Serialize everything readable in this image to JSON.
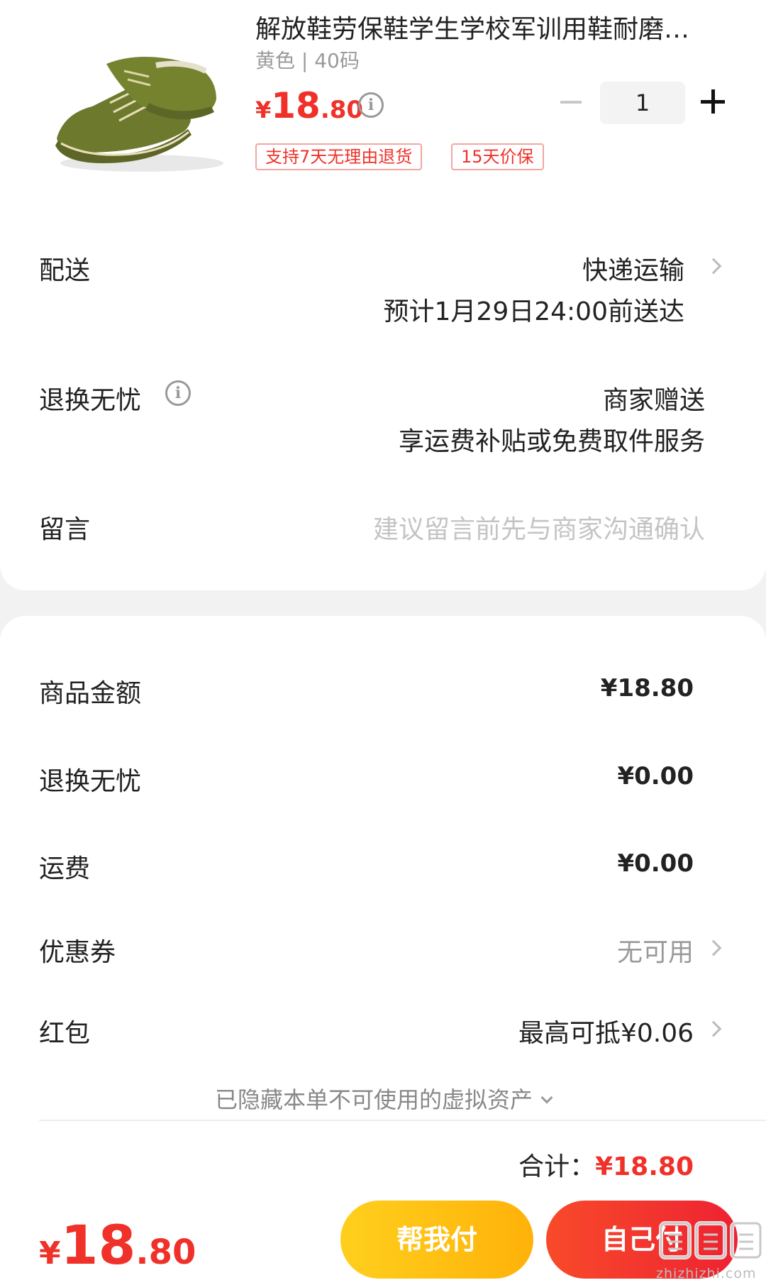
{
  "product": {
    "title": "解放鞋劳保鞋学生学校军训用鞋耐磨…",
    "spec": "黄色 | 40码",
    "price": {
      "currency": "¥",
      "integer": "18",
      "decimal": ".80"
    },
    "quantity": "1",
    "tags": [
      "支持7天无理由退货",
      "15天价保"
    ],
    "image_icon": "shoe-image"
  },
  "shipping": {
    "label": "配送",
    "method": "快递运输",
    "eta": "预计1月29日24:00前送达"
  },
  "returns": {
    "label": "退换无忧",
    "value": "商家赠送",
    "detail": "享运费补贴或免费取件服务"
  },
  "message": {
    "label": "留言",
    "placeholder": "建议留言前先与商家沟通确认"
  },
  "summary": {
    "goods_amount_label": "商品金额",
    "goods_amount": "¥18.80",
    "returns_fee_label": "退换无忧",
    "returns_fee": "¥0.00",
    "shipping_fee_label": "运费",
    "shipping_fee": "¥0.00",
    "coupon_label": "优惠券",
    "coupon_value": "无可用",
    "redpacket_label": "红包",
    "redpacket_value": "最高可抵¥0.06",
    "hidden_assets_note": "已隐藏本单不可使用的虚拟资产",
    "total_label": "合计：",
    "total_value": "¥18.80"
  },
  "footer": {
    "price": {
      "currency": "¥",
      "integer": "18",
      "decimal": ".80"
    },
    "help_pay_label": "帮我付",
    "self_pay_label": "自己付"
  },
  "watermark": {
    "logo": "值值值",
    "url": "zhizhizhi.com"
  },
  "colors": {
    "accent": "#f0312a",
    "yellow_button": "#ffc012",
    "red_button": "#f2362d",
    "background": "#f2f2f2"
  }
}
